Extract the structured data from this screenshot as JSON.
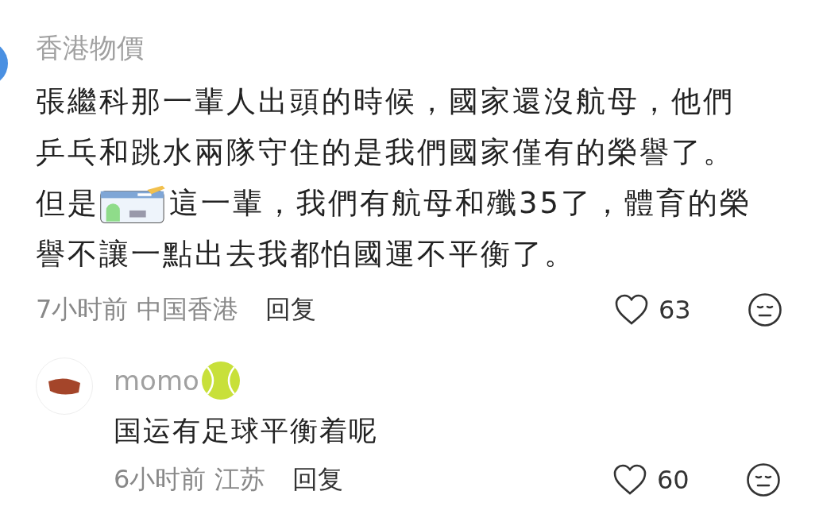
{
  "comment": {
    "author": "香港物價",
    "text_before_sticker": "張繼科那一輩人出頭的時候，國家還沒航母，他們乒乓和跳水兩隊守住的是我們國家僅有的榮譽了。但是",
    "text_after_sticker": "這一輩，我們有航母和殲35了，體育的榮譽不讓一點出去我都怕國運不平衡了。",
    "meta": "7小时前 中国香港",
    "reply_label": "回复",
    "likes": "63",
    "reply": {
      "author": "momo",
      "text": "国运有足球平衡着呢",
      "meta": "6小时前 江苏",
      "reply_label": "回复",
      "likes": "60"
    }
  }
}
